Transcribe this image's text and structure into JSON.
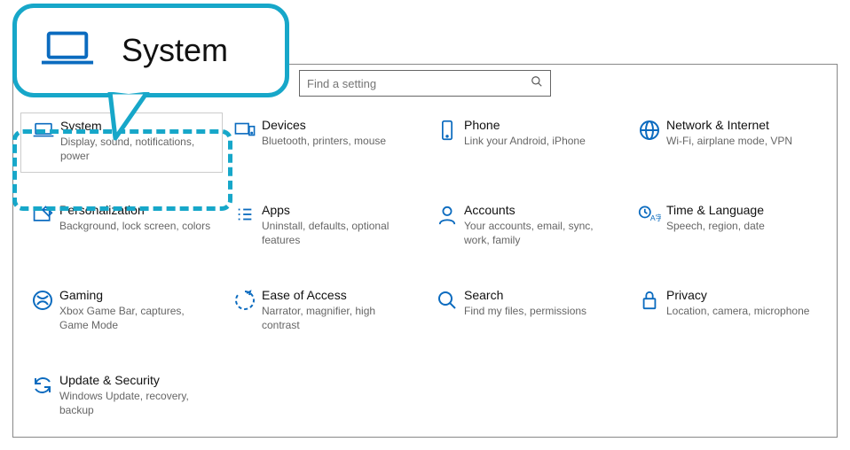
{
  "callout": {
    "title": "System"
  },
  "search": {
    "placeholder": "Find a setting"
  },
  "tiles": [
    {
      "title": "System",
      "desc": "Display, sound, notifications, power"
    },
    {
      "title": "Devices",
      "desc": "Bluetooth, printers, mouse"
    },
    {
      "title": "Phone",
      "desc": "Link your Android, iPhone"
    },
    {
      "title": "Network & Internet",
      "desc": "Wi-Fi, airplane mode, VPN"
    },
    {
      "title": "Personalization",
      "desc": "Background, lock screen, colors"
    },
    {
      "title": "Apps",
      "desc": "Uninstall, defaults, optional features"
    },
    {
      "title": "Accounts",
      "desc": "Your accounts, email, sync, work, family"
    },
    {
      "title": "Time & Language",
      "desc": "Speech, region, date"
    },
    {
      "title": "Gaming",
      "desc": "Xbox Game Bar, captures, Game Mode"
    },
    {
      "title": "Ease of Access",
      "desc": "Narrator, magnifier, high contrast"
    },
    {
      "title": "Search",
      "desc": "Find my files, permissions"
    },
    {
      "title": "Privacy",
      "desc": "Location, camera, microphone"
    },
    {
      "title": "Update & Security",
      "desc": "Windows Update, recovery, backup"
    }
  ]
}
